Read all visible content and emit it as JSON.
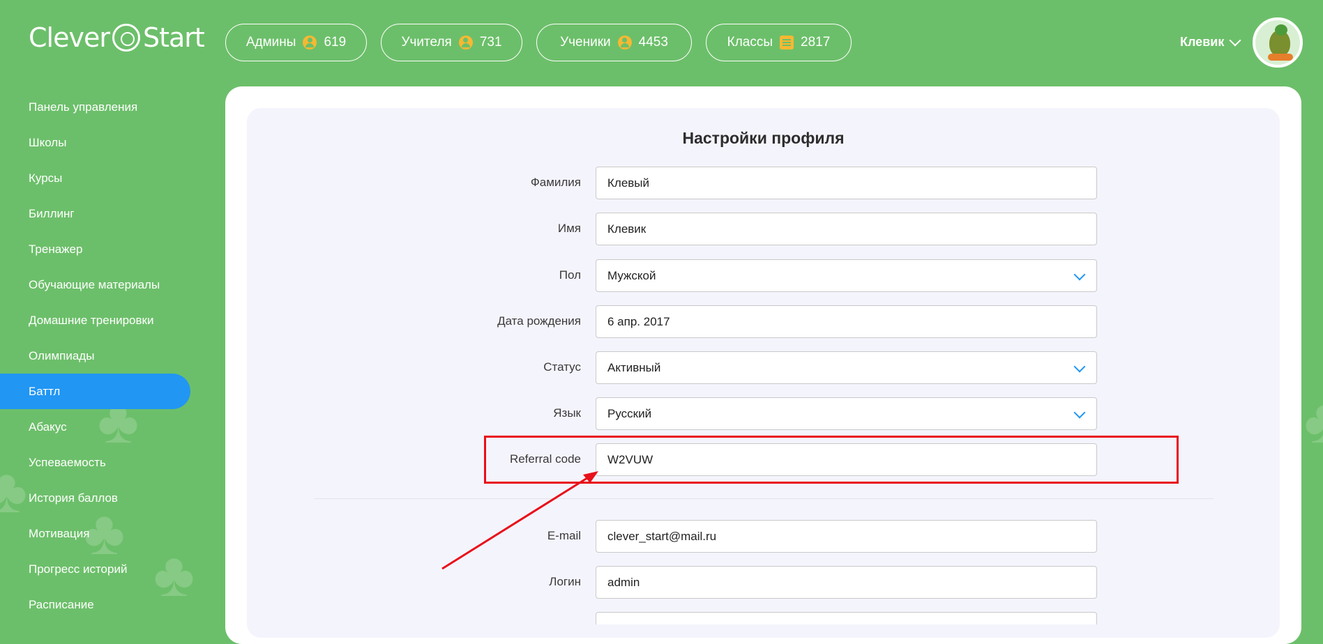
{
  "header": {
    "logo_text": "Clever",
    "logo_text2": "Start",
    "stats": [
      {
        "label": "Админы",
        "icon": "user-icon",
        "count": "619"
      },
      {
        "label": "Учителя",
        "icon": "user-icon",
        "count": "731"
      },
      {
        "label": "Ученики",
        "icon": "user-icon",
        "count": "4453"
      },
      {
        "label": "Классы",
        "icon": "list-icon",
        "count": "2817"
      }
    ],
    "user_name": "Клевик"
  },
  "sidebar": {
    "items": [
      {
        "label": "Панель управления"
      },
      {
        "label": "Школы"
      },
      {
        "label": "Курсы"
      },
      {
        "label": "Биллинг"
      },
      {
        "label": "Тренажер"
      },
      {
        "label": "Обучающие материалы"
      },
      {
        "label": "Домашние тренировки"
      },
      {
        "label": "Олимпиады"
      },
      {
        "label": "Баттл",
        "active": true
      },
      {
        "label": "Абакус"
      },
      {
        "label": "Успеваемость"
      },
      {
        "label": "История баллов"
      },
      {
        "label": "Мотивация"
      },
      {
        "label": "Прогресс историй"
      },
      {
        "label": "Расписание"
      }
    ]
  },
  "form": {
    "title": "Настройки профиля",
    "fields": [
      {
        "label": "Фамилия",
        "value": "Клевый",
        "type": "text"
      },
      {
        "label": "Имя",
        "value": "Клевик",
        "type": "text"
      },
      {
        "label": "Пол",
        "value": "Мужской",
        "type": "select"
      },
      {
        "label": "Дата рождения",
        "value": "6 апр. 2017",
        "type": "text"
      },
      {
        "label": "Статус",
        "value": "Активный",
        "type": "select"
      },
      {
        "label": "Язык",
        "value": "Русский",
        "type": "select"
      },
      {
        "label": "Referral code",
        "value": "W2VUW",
        "type": "text"
      },
      {
        "label": "E-mail",
        "value": "clever_start@mail.ru",
        "type": "text"
      },
      {
        "label": "Логин",
        "value": "admin",
        "type": "text"
      },
      {
        "label": "",
        "value": "",
        "type": "text"
      }
    ]
  },
  "colors": {
    "background": "#6cbf6a",
    "accent": "#2196f3",
    "highlight": "#e8101a",
    "badge": "#f6b833"
  }
}
